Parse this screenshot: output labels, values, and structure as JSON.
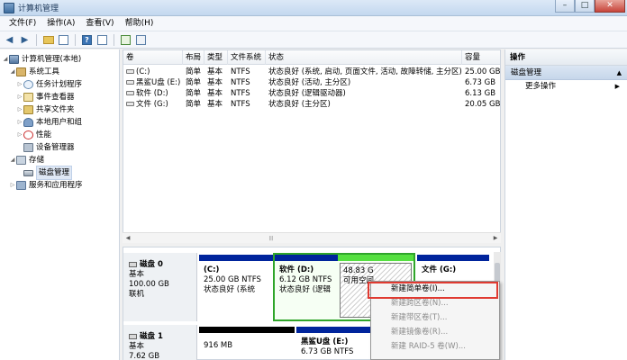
{
  "window": {
    "title": "计算机管理"
  },
  "menu": [
    {
      "label": "文件(F)"
    },
    {
      "label": "操作(A)"
    },
    {
      "label": "查看(V)"
    },
    {
      "label": "帮助(H)"
    }
  ],
  "tree": {
    "items": [
      {
        "label": "计算机管理(本地)",
        "icon": "computer-icon"
      },
      {
        "label": "系统工具",
        "icon": "tools-icon"
      },
      {
        "label": "任务计划程序",
        "icon": "clock-icon"
      },
      {
        "label": "事件查看器",
        "icon": "event-log-icon"
      },
      {
        "label": "共享文件夹",
        "icon": "shared-folder-icon"
      },
      {
        "label": "本地用户和组",
        "icon": "users-icon"
      },
      {
        "label": "性能",
        "icon": "performance-icon"
      },
      {
        "label": "设备管理器",
        "icon": "device-manager-icon"
      },
      {
        "label": "存储",
        "icon": "storage-icon"
      },
      {
        "label": "磁盘管理",
        "icon": "disk-icon"
      },
      {
        "label": "服务和应用程序",
        "icon": "services-icon"
      }
    ]
  },
  "volumes": {
    "columns": [
      "卷",
      "布局",
      "类型",
      "文件系统",
      "状态",
      "容量"
    ],
    "rows": [
      {
        "name": "(C:)",
        "layout": "简单",
        "type": "基本",
        "fs": "NTFS",
        "status": "状态良好 (系统, 启动, 页面文件, 活动, 故障转储, 主分区)",
        "capacity": "25.00 GB"
      },
      {
        "name": "黑鲨U盘 (E:)",
        "layout": "简单",
        "type": "基本",
        "fs": "NTFS",
        "status": "状态良好 (活动, 主分区)",
        "capacity": "6.73 GB"
      },
      {
        "name": "软件 (D:)",
        "layout": "简单",
        "type": "基本",
        "fs": "NTFS",
        "status": "状态良好 (逻辑驱动器)",
        "capacity": "6.13 GB"
      },
      {
        "name": "文件 (G:)",
        "layout": "简单",
        "type": "基本",
        "fs": "NTFS",
        "status": "状态良好 (主分区)",
        "capacity": "20.05 GB"
      }
    ]
  },
  "disks": [
    {
      "name": "磁盘 0",
      "type": "基本",
      "size": "100.00 GB",
      "state": "联机",
      "partitions": [
        {
          "title": "(C:)",
          "size": "25.00 GB NTFS",
          "status": "状态良好 (系统"
        },
        {
          "title": "软件 (D:)",
          "size": "6.12 GB NTFS",
          "status": "状态良好 (逻辑"
        },
        {
          "title": "",
          "size": "48.83 G",
          "status": "可用空间"
        },
        {
          "title": "文件 (G:)",
          "size": "",
          "status": ""
        }
      ]
    },
    {
      "name": "磁盘 1",
      "type": "基本",
      "size": "7.62 GB",
      "partitions": [
        {
          "title": "",
          "size": "916 MB",
          "status": ""
        },
        {
          "title": "黑鲨U盘 (E:)",
          "size": "6.73 GB NTFS",
          "status": ""
        }
      ]
    }
  ],
  "actions": {
    "header": "操作",
    "section": "磁盘管理",
    "items": [
      {
        "label": "更多操作"
      }
    ]
  },
  "context_menu": {
    "items": [
      {
        "label": "新建简单卷(I)...",
        "enabled": true
      },
      {
        "label": "新建跨区卷(N)...",
        "enabled": false
      },
      {
        "label": "新建带区卷(T)...",
        "enabled": false
      },
      {
        "label": "新建镜像卷(R)...",
        "enabled": false
      },
      {
        "label": "新建 RAID-5 卷(W)...",
        "enabled": false
      }
    ]
  },
  "colors": {
    "primary_partition": "#00249c",
    "unallocated": "#000000",
    "free_space": "#55e040",
    "highlight": "#e03a31"
  }
}
